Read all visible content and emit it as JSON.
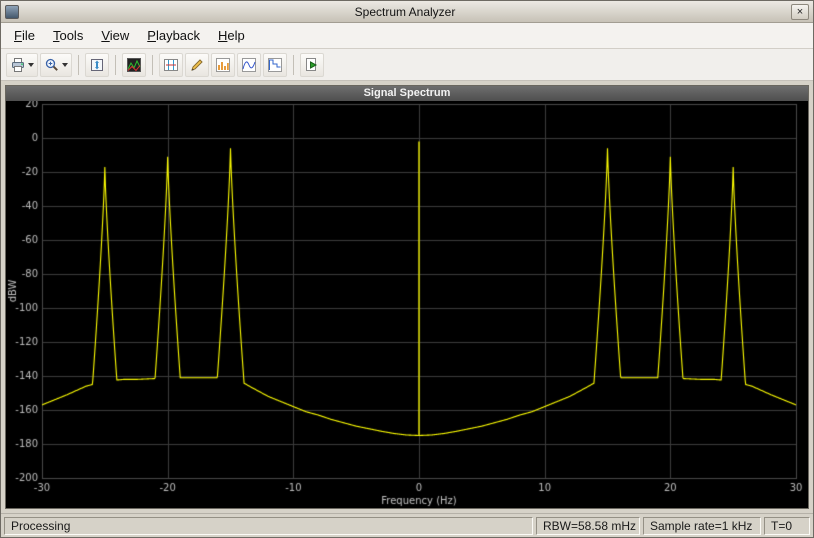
{
  "window": {
    "title": "Spectrum Analyzer",
    "close_label": "×"
  },
  "menubar": {
    "items": [
      {
        "label": "File"
      },
      {
        "label": "Tools"
      },
      {
        "label": "View"
      },
      {
        "label": "Playback"
      },
      {
        "label": "Help"
      }
    ]
  },
  "toolbar": {
    "buttons": [
      {
        "icon": "print-icon",
        "has_dropdown": true
      },
      {
        "icon": "zoom-icon",
        "has_dropdown": true
      },
      {
        "icon": "full-span-icon",
        "has_dropdown": false
      },
      {
        "icon": "spectrum-settings-icon",
        "has_dropdown": false
      },
      {
        "icon": "cursor-measurements-icon",
        "has_dropdown": false
      },
      {
        "icon": "peak-finder-icon",
        "has_dropdown": false
      },
      {
        "icon": "distortion-measurements-icon",
        "has_dropdown": false
      },
      {
        "icon": "signal-statistics-icon",
        "has_dropdown": false
      },
      {
        "icon": "ccdf-measurements-icon",
        "has_dropdown": false
      },
      {
        "icon": "step-forward-icon",
        "has_dropdown": false
      }
    ]
  },
  "chart_data": {
    "type": "line",
    "title": "Signal Spectrum",
    "xlabel": "Frequency (Hz)",
    "ylabel": "dBW",
    "xlim": [
      -30,
      30
    ],
    "ylim": [
      -200,
      20
    ],
    "xticks": [
      -30,
      -20,
      -10,
      0,
      10,
      20,
      30
    ],
    "yticks": [
      20,
      0,
      -20,
      -40,
      -60,
      -80,
      -100,
      -120,
      -140,
      -160,
      -180,
      -200
    ],
    "grid": true,
    "bg_color": "#000000",
    "grid_color": "#3c3c3c",
    "tick_color": "#bcbcbc",
    "line_color": "#ffff00",
    "peaks": [
      {
        "f": -25,
        "dB": -17
      },
      {
        "f": -20,
        "dB": -11
      },
      {
        "f": -15,
        "dB": -6
      },
      {
        "f": 15,
        "dB": -6
      },
      {
        "f": 20,
        "dB": -11
      },
      {
        "f": 25,
        "dB": -17
      }
    ],
    "dc_spike": {
      "f": 0,
      "dB": -2
    },
    "peak_skirt": {
      "coeff": 130,
      "exponent": 0.8
    },
    "baseline_points": [
      [
        -30,
        -157
      ],
      [
        -28,
        -151
      ],
      [
        -26.5,
        -146
      ],
      [
        -25,
        -143
      ],
      [
        -23.5,
        -142
      ],
      [
        -22.5,
        -142
      ],
      [
        -21,
        -141.5
      ],
      [
        -20,
        -141
      ],
      [
        -18.5,
        -141
      ],
      [
        -17.5,
        -141
      ],
      [
        -16,
        -141
      ],
      [
        -15,
        -141
      ],
      [
        -14.2,
        -143
      ],
      [
        -13.5,
        -146
      ],
      [
        -13,
        -148
      ],
      [
        -12,
        -152
      ],
      [
        -11,
        -155
      ],
      [
        -10,
        -158
      ],
      [
        -9,
        -161
      ],
      [
        -8,
        -163
      ],
      [
        -7,
        -165.5
      ],
      [
        -6,
        -167.5
      ],
      [
        -5,
        -169.5
      ],
      [
        -4,
        -171
      ],
      [
        -3,
        -172.5
      ],
      [
        -2,
        -173.8
      ],
      [
        -1,
        -174.7
      ],
      [
        0,
        -175
      ],
      [
        1,
        -174.7
      ],
      [
        2,
        -173.8
      ],
      [
        3,
        -172.5
      ],
      [
        4,
        -171
      ],
      [
        5,
        -169.5
      ],
      [
        6,
        -167.5
      ],
      [
        7,
        -165.5
      ],
      [
        8,
        -163
      ],
      [
        9,
        -161
      ],
      [
        10,
        -158
      ],
      [
        11,
        -155
      ],
      [
        12,
        -152
      ],
      [
        13,
        -148
      ],
      [
        13.5,
        -146
      ],
      [
        14.2,
        -143
      ],
      [
        15,
        -141
      ],
      [
        16,
        -141
      ],
      [
        17.5,
        -141
      ],
      [
        18.5,
        -141
      ],
      [
        20,
        -141
      ],
      [
        21,
        -141.5
      ],
      [
        22.5,
        -142
      ],
      [
        23.5,
        -142
      ],
      [
        25,
        -143
      ],
      [
        26.5,
        -146
      ],
      [
        28,
        -151
      ],
      [
        30,
        -157
      ]
    ]
  },
  "statusbar": {
    "status": "Processing",
    "rbw": "RBW=58.58 mHz",
    "sample_rate": "Sample rate=1 kHz",
    "time": "T=0"
  }
}
